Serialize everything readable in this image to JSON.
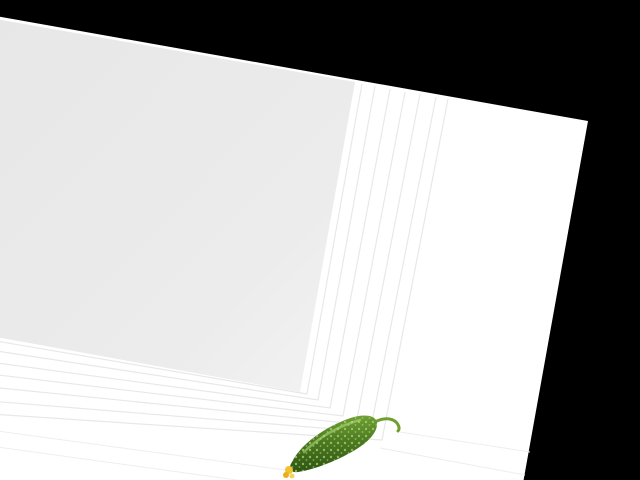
{
  "scene": {
    "subject_icon": "cucumber-icon",
    "background_color": "#000000",
    "photo_frame_color": "#ffffff",
    "inner_panel_color": "#eaeaea",
    "cucumber_color": "#4f7f24",
    "cucumber_bump_color": "#9bd65b",
    "stem_color": "#6f9f2e",
    "flower_color": "#f2c12e"
  }
}
